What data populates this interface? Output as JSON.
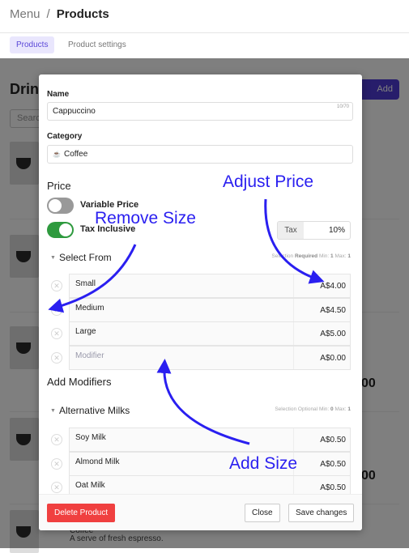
{
  "header": {
    "breadcrumb_root": "Menu",
    "separator": "/",
    "current": "Products"
  },
  "tabs": [
    {
      "label": "Products",
      "active": true
    },
    {
      "label": "Product settings",
      "active": false
    }
  ],
  "background": {
    "title": "Drinks",
    "add_button": "Add product",
    "search_placeholder": "Search",
    "price_fragment": "00",
    "last_item_name": "Coffee",
    "last_item_desc": "A serve of fresh espresso."
  },
  "modal": {
    "name_label": "Name",
    "name_value": "Cappuccino",
    "name_count": "10/70",
    "category_label": "Category",
    "category_icon": "cup-icon",
    "category_value": "Coffee",
    "price_heading": "Price",
    "variable_price": {
      "label": "Variable Price",
      "on": false
    },
    "tax_inclusive": {
      "label": "Tax Inclusive",
      "on": true
    },
    "tax": {
      "label": "Tax",
      "value": "10%"
    },
    "select_from": {
      "title": "Select From",
      "meta_prefix": "Selection",
      "meta_req": "Required",
      "meta_min": "Min:",
      "min": "1",
      "meta_max": "Max:",
      "max": "1",
      "options": [
        {
          "name": "Small",
          "price": "A$4.00"
        },
        {
          "name": "Medium",
          "price": "A$4.50"
        },
        {
          "name": "Large",
          "price": "A$5.00"
        },
        {
          "name": "Modifier",
          "price": "A$0.00",
          "placeholder": true
        }
      ]
    },
    "add_modifiers": "Add Modifiers",
    "alt_milks": {
      "title": "Alternative Milks",
      "meta_prefix": "Selection",
      "meta_req": "Optional",
      "meta_min": "Min:",
      "min": "0",
      "meta_max": "Max:",
      "max": "1",
      "options": [
        {
          "name": "Soy Milk",
          "price": "A$0.50"
        },
        {
          "name": "Almond Milk",
          "price": "A$0.50"
        },
        {
          "name": "Oat Milk",
          "price": "A$0.50"
        }
      ]
    },
    "delete_button": "Delete Product",
    "close_button": "Close",
    "save_button": "Save changes"
  },
  "annotations": {
    "adjust_price": "Adjust Price",
    "remove_size": "Remove Size",
    "add_size": "Add Size",
    "color": "#2a1ff0"
  },
  "colors": {
    "accent": "#5a47d8",
    "danger": "#f04040",
    "toggle_on": "#2e9a3e"
  }
}
